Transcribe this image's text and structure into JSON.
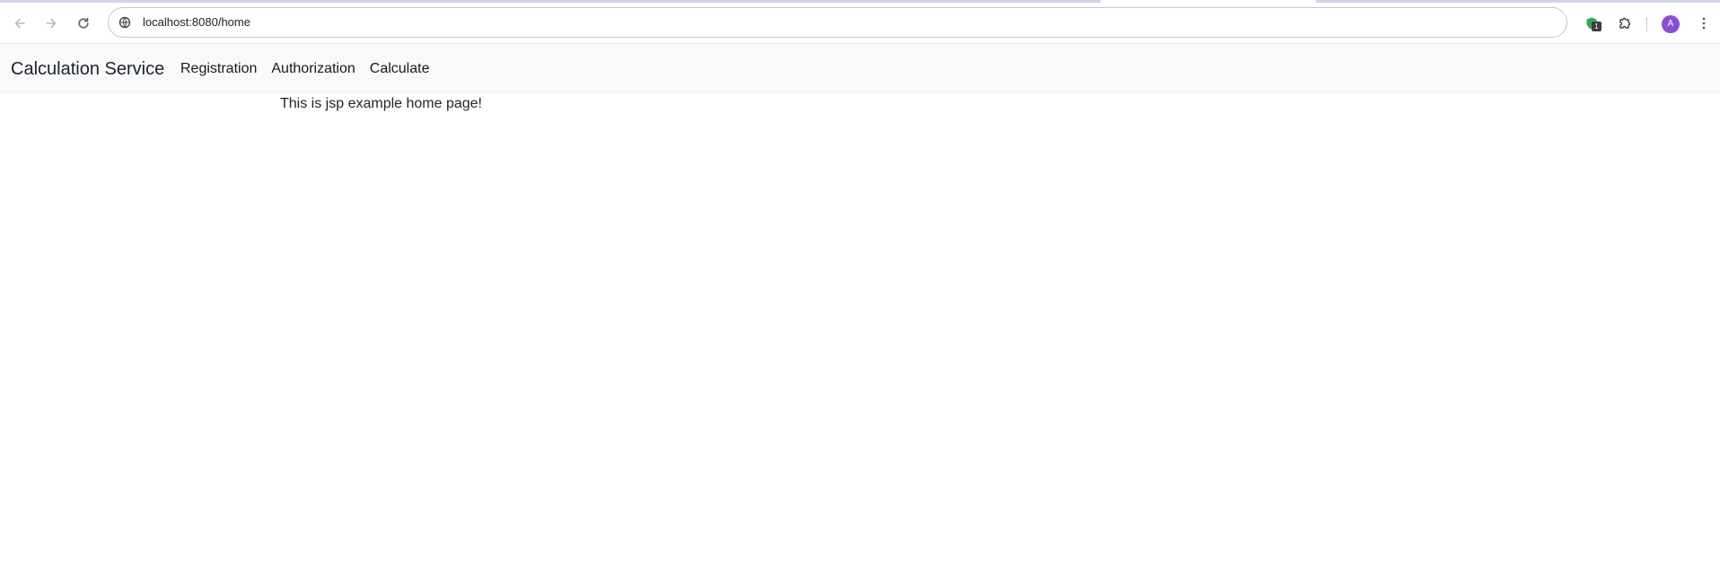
{
  "browser": {
    "url": "localhost:8080/home",
    "extension_badge": "1",
    "avatar_letter": "A",
    "icons": [
      "back-arrow-icon",
      "forward-arrow-icon",
      "reload-icon",
      "site-info-icon",
      "shield-extension-icon",
      "puzzle-extensions-icon",
      "kebab-menu-icon"
    ]
  },
  "navbar": {
    "brand": "Calculation Service",
    "links": [
      {
        "label": "Registration"
      },
      {
        "label": "Authorization"
      },
      {
        "label": "Calculate"
      }
    ]
  },
  "main": {
    "text": "This is jsp example home page!"
  },
  "colors": {
    "navbar_bg": "#f8f9fa",
    "avatar_bg": "#8a4fd1",
    "extension_green": "#34a853"
  }
}
